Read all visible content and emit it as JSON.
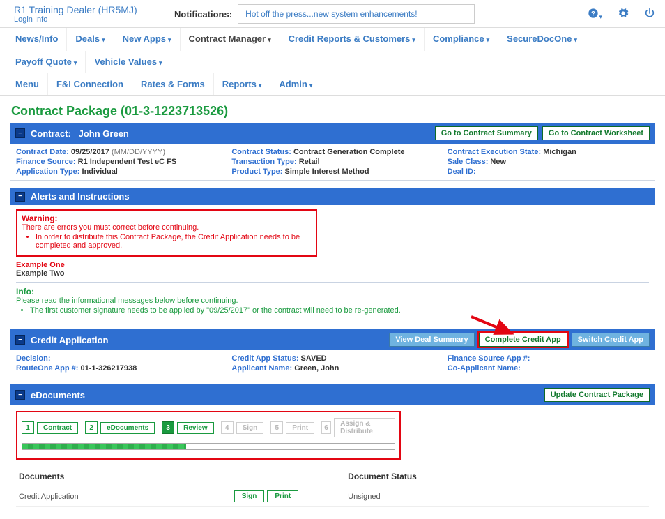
{
  "topbar": {
    "dealer_name": "R1 Training Dealer (HR5MJ)",
    "login_info": "Login Info",
    "notif_label": "Notifications:",
    "notif_text": "Hot off the press...new system enhancements!"
  },
  "nav": {
    "row1": [
      "News/Info",
      "Deals",
      "New Apps",
      "Contract Manager",
      "Credit Reports & Customers",
      "Compliance",
      "SecureDocOne",
      "Payoff Quote",
      "Vehicle Values"
    ],
    "row2": [
      "Menu",
      "F&I Connection",
      "Rates & Forms",
      "Reports",
      "Admin"
    ],
    "active": "Contract Manager"
  },
  "page_title": "Contract Package (01-3-1223713526)",
  "contract": {
    "bar_title_prefix": "Contract:",
    "bar_title_name": "John Green",
    "buttons": {
      "summary": "Go to Contract Summary",
      "worksheet": "Go to Contract Worksheet"
    },
    "col1": {
      "date_label": "Contract Date:",
      "date_value": "09/25/2017",
      "date_fmt": "(MM/DD/YYYY)",
      "fs_label": "Finance Source:",
      "fs_value": "R1 Independent Test eC FS",
      "apptype_label": "Application Type:",
      "apptype_value": "Individual"
    },
    "col2": {
      "status_label": "Contract Status:",
      "status_value": "Contract Generation Complete",
      "txn_label": "Transaction Type:",
      "txn_value": "Retail",
      "prod_label": "Product Type:",
      "prod_value": "Simple Interest Method"
    },
    "col3": {
      "exec_label": "Contract Execution State:",
      "exec_value": "Michigan",
      "sale_label": "Sale Class:",
      "sale_value": "New",
      "deal_label": "Deal ID:",
      "deal_value": ""
    }
  },
  "alerts": {
    "bar_title": "Alerts and Instructions",
    "warn_title": "Warning:",
    "warn_text": "There are errors you must correct before continuing.",
    "warn_item": "In order to distribute this Contract Package, the Credit Application needs to be completed and approved.",
    "example1": "Example One",
    "example2": "Example Two",
    "info_title": "Info:",
    "info_text": "Please read the informational messages below before continuing.",
    "info_item": "The first customer signature needs to be applied by \"09/25/2017\" or the contract will need to be re-generated."
  },
  "creditapp": {
    "bar_title": "Credit Application",
    "buttons": {
      "view": "View Deal Summary",
      "complete": "Complete Credit App",
      "switch": "Switch Credit App"
    },
    "col1": {
      "decision_label": "Decision:",
      "decision_value": "",
      "r1app_label": "RouteOne App #:",
      "r1app_value": "01-1-326217938"
    },
    "col2": {
      "status_label": "Credit App Status:",
      "status_value": "SAVED",
      "appname_label": "Applicant Name:",
      "appname_value": "Green, John"
    },
    "col3": {
      "fsapp_label": "Finance Source App #:",
      "fsapp_value": "",
      "coapp_label": "Co-Applicant Name:",
      "coapp_value": ""
    }
  },
  "edocs": {
    "bar_title": "eDocuments",
    "update_btn": "Update Contract Package",
    "steps": [
      {
        "num": "1",
        "label": "Contract",
        "state": "done"
      },
      {
        "num": "2",
        "label": "eDocuments",
        "state": "done"
      },
      {
        "num": "3",
        "label": "Review",
        "state": "current"
      },
      {
        "num": "4",
        "label": "Sign",
        "state": "pending"
      },
      {
        "num": "5",
        "label": "Print",
        "state": "pending"
      },
      {
        "num": "6",
        "label": "Assign & Distribute",
        "state": "pending"
      }
    ],
    "progress_pct": 44,
    "table": {
      "head_doc": "Documents",
      "head_status": "Document Status",
      "rows": [
        {
          "name": "Credit Application",
          "btn_sign": "Sign",
          "btn_print": "Print",
          "status": "Unsigned"
        }
      ]
    }
  }
}
